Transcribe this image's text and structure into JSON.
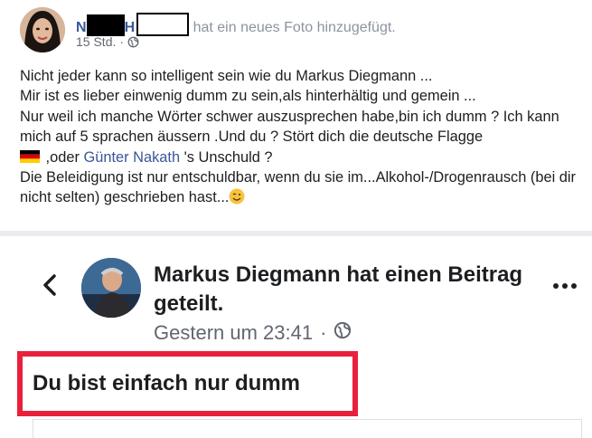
{
  "post": {
    "author_fragment": "N",
    "action": "hat ein neues Foto hinzugefügt.",
    "timestamp": "15 Std.",
    "separator": "·",
    "privacy_icon": "globe-icon",
    "text": {
      "line1": "Nicht jeder kann so intelligent sein wie du Markus Diegmann ...",
      "line2": "Mir ist es lieber einwenig dumm zu sein,als hinterhältig und gemein ...",
      "line3": "Nur weil ich manche Wörter schwer auszusprechen habe,bin ich dumm ? Ich kann mich auf 5 sprachen äussern .Und du ? Stört dich die deutsche Flagge",
      "line4_pre": " ,oder ",
      "mention": "Günter Nakath",
      "line4_post": " 's Unschuld ?",
      "line5": "Die Beleidigung ist nur entschuldbar, wenn du sie im...Alkohol-/Drogenrausch (bei dir nicht selten) geschrieben hast...",
      "flag_icon": "german-flag-icon",
      "emoji_icon": "smiley-emoji-icon"
    }
  },
  "shared": {
    "title": "Markus Diegmann hat einen Beitrag geteilt.",
    "timestamp": "Gestern um 23:41",
    "separator": "·",
    "privacy_icon": "globe-icon",
    "back_icon": "chevron-left-icon",
    "more_icon": "more-options-icon",
    "content": "Du bist einfach nur dumm"
  },
  "colors": {
    "link": "#365899",
    "highlight_border": "#e8203b",
    "meta": "#616770"
  }
}
